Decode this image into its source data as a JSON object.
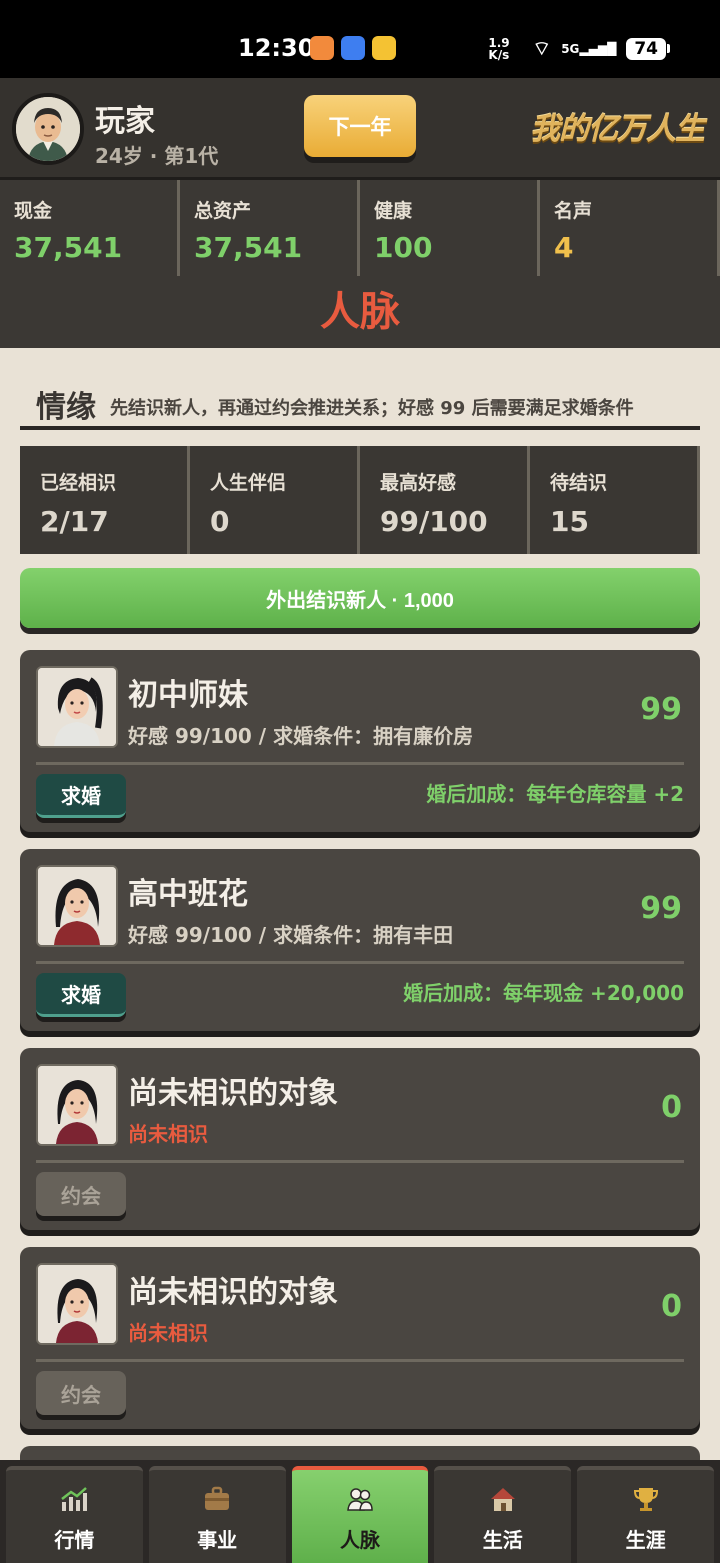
{
  "status_bar": {
    "time": "12:30",
    "net_speed": "1.9 K/s",
    "signal": "5G",
    "battery": "74"
  },
  "header": {
    "player_name": "玩家",
    "player_sub": "24岁 · 第1代",
    "next_year_label": "下一年",
    "logo_text": "我的亿万人生"
  },
  "stats": [
    {
      "label": "现金",
      "value": "37,541"
    },
    {
      "label": "总资产",
      "value": "37,541"
    },
    {
      "label": "健康",
      "value": "100"
    },
    {
      "label": "名声",
      "value": "4"
    }
  ],
  "section_title": "人脉",
  "romance": {
    "title": "情缘",
    "description": "先结识新人，再通过约会推进关系；好感 99 后需要满足求婚条件",
    "stats": [
      {
        "label": "已经相识",
        "value": "2/17"
      },
      {
        "label": "人生伴侣",
        "value": "0"
      },
      {
        "label": "最高好感",
        "value": "99/100"
      },
      {
        "label": "待结识",
        "value": "15"
      }
    ],
    "go_out_button": "外出结识新人 · 1,000",
    "cards": [
      {
        "name": "初中师妹",
        "info": "好感 99/100 / 求婚条件：拥有廉价房",
        "score": "99",
        "action": "求婚",
        "bonus": "婚后加成：每年仓库容量 +2"
      },
      {
        "name": "高中班花",
        "info": "好感 99/100 / 求婚条件：拥有丰田",
        "score": "99",
        "action": "求婚",
        "bonus": "婚后加成：每年现金 +20,000"
      },
      {
        "name": "尚未相识的对象",
        "info": "尚未相识",
        "score": "0",
        "action": "约会",
        "bonus": ""
      },
      {
        "name": "尚未相识的对象",
        "info": "尚未相识",
        "score": "0",
        "action": "约会",
        "bonus": ""
      }
    ]
  },
  "tabs": [
    {
      "label": "行情",
      "icon": "chart-icon"
    },
    {
      "label": "事业",
      "icon": "briefcase-icon"
    },
    {
      "label": "人脉",
      "icon": "people-icon"
    },
    {
      "label": "生活",
      "icon": "house-icon"
    },
    {
      "label": "生涯",
      "icon": "trophy-icon"
    }
  ],
  "colors": {
    "accent_red": "#e85b3f",
    "green": "#7fd06a",
    "gold": "#f0c04c",
    "dark_panel": "#3a3733"
  }
}
